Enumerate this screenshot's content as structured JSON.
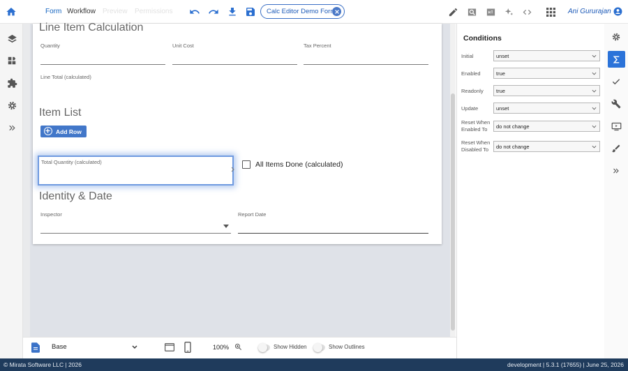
{
  "topbar": {
    "tabs": [
      {
        "label": "Form",
        "active": true
      },
      {
        "label": "Workflow",
        "active": false
      },
      {
        "label": "Preview",
        "active": false
      },
      {
        "label": "Permissions",
        "active": false
      }
    ],
    "form_chip": "Calc Editor Demo Form",
    "user_name": "Ani Gururajan"
  },
  "sections": {
    "line_item": {
      "title": "Line Item Calculation",
      "quantity_label": "Quantity",
      "unit_cost_label": "Unit Cost",
      "tax_percent_label": "Tax Percent",
      "line_total_label": "Line Total (calculated)"
    },
    "item_list": {
      "title": "Item List",
      "add_row_label": "Add Row",
      "total_quantity_label": "Total Quantity (calculated)",
      "all_items_done_label": "All Items Done (calculated)"
    },
    "identity": {
      "title": "Identity & Date",
      "inspector_label": "Inspector",
      "report_date_label": "Report Date"
    }
  },
  "conditions": {
    "title": "Conditions",
    "rows": [
      {
        "label": "Initial",
        "value": "unset"
      },
      {
        "label": "Enabled",
        "value": "true"
      },
      {
        "label": "Readonly",
        "value": "true"
      },
      {
        "label": "Update",
        "value": "unset"
      },
      {
        "label_line1": "Reset When",
        "label_line2": "Enabled To",
        "value": "do not change"
      },
      {
        "label_line1": "Reset When",
        "label_line2": "Disabled To",
        "value": "do not change"
      }
    ]
  },
  "bottombar": {
    "layout_select": "Base",
    "zoom": "100%",
    "show_hidden_label": "Show Hidden",
    "show_outlines_label": "Show Outlines",
    "show_hidden_on": false,
    "show_outlines_on": false
  },
  "footer": {
    "left": "© Mirata Software LLC | 2026",
    "right": "development | 5.3.1 (17655) | June 25, 2026"
  },
  "colors": {
    "accent": "#2b73d9",
    "footer_bg": "#1f3b5c",
    "canvas_bg": "#dfe2e8"
  }
}
